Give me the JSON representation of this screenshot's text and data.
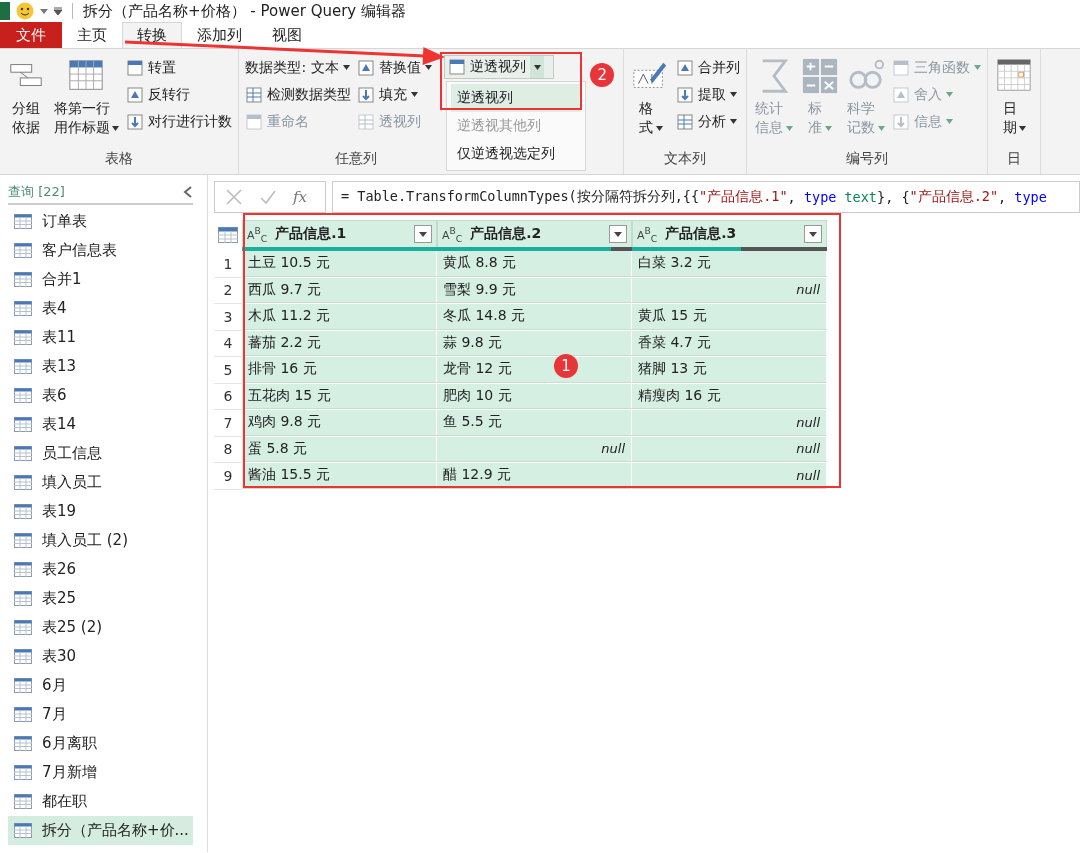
{
  "title_bar": {
    "title": "拆分（产品名称+价格） - Power Query 编辑器"
  },
  "tabs": [
    {
      "label": "文件",
      "kind": "file",
      "selected": false
    },
    {
      "label": "主页",
      "kind": "tab",
      "selected": false
    },
    {
      "label": "转换",
      "kind": "tab",
      "selected": true
    },
    {
      "label": "添加列",
      "kind": "tab",
      "selected": false
    },
    {
      "label": "视图",
      "kind": "tab",
      "selected": false
    }
  ],
  "ribbon": {
    "groups": [
      {
        "label": "表格",
        "columns": [
          {
            "kind": "large",
            "label": "分组依据",
            "dropdown": false,
            "disabled": false
          },
          {
            "kind": "large",
            "label": "将第一行用作标题",
            "dropdown": true,
            "disabled": false
          },
          {
            "kind": "stack",
            "items": [
              {
                "kind": "command",
                "label": "转置",
                "dropdown": false,
                "disabled": false
              },
              {
                "kind": "command",
                "label": "反转行",
                "dropdown": false,
                "disabled": false
              },
              {
                "kind": "command",
                "label": "对行进行计数",
                "dropdown": false,
                "disabled": false
              }
            ]
          }
        ]
      },
      {
        "label": "任意列",
        "columns": [
          {
            "kind": "stack",
            "items": [
              {
                "kind": "menu",
                "label": "数据类型: 文本",
                "dropdown": true,
                "disabled": false
              },
              {
                "kind": "command",
                "label": "检测数据类型",
                "dropdown": false,
                "disabled": false
              },
              {
                "kind": "command",
                "label": "重命名",
                "dropdown": false,
                "disabled": true
              }
            ]
          },
          {
            "kind": "stack",
            "items": [
              {
                "kind": "command",
                "label": "替换值",
                "dropdown": true,
                "disabled": false
              },
              {
                "kind": "command",
                "label": "填充",
                "dropdown": true,
                "disabled": false
              },
              {
                "kind": "command",
                "label": "透视列",
                "dropdown": false,
                "disabled": true
              }
            ]
          },
          {
            "kind": "split",
            "label": "逆透视列",
            "menu": [
              {
                "label": "逆透视列",
                "selected": true,
                "disabled": false
              },
              {
                "label": "逆透视其他列",
                "selected": false,
                "disabled": true
              },
              {
                "label": "仅逆透视选定列",
                "selected": false,
                "disabled": false
              }
            ]
          }
        ]
      },
      {
        "label": "文本列",
        "columns": [
          {
            "kind": "large",
            "label": "格式",
            "dropdown": true,
            "disabled": false
          },
          {
            "kind": "stack",
            "items": [
              {
                "kind": "command",
                "label": "合并列",
                "dropdown": false,
                "disabled": false
              },
              {
                "kind": "command",
                "label": "提取",
                "dropdown": true,
                "disabled": false
              },
              {
                "kind": "command",
                "label": "分析",
                "dropdown": true,
                "disabled": false
              }
            ]
          }
        ]
      },
      {
        "label": "编号列",
        "columns": [
          {
            "kind": "large",
            "label": "统计信息",
            "dropdown": true,
            "disabled": true
          },
          {
            "kind": "large",
            "label": "标准",
            "dropdown": true,
            "disabled": true
          },
          {
            "kind": "large",
            "label": "科学记数",
            "dropdown": true,
            "disabled": true
          },
          {
            "kind": "stack",
            "items": [
              {
                "kind": "command",
                "label": "三角函数",
                "dropdown": true,
                "disabled": true
              },
              {
                "kind": "command",
                "label": "舍入",
                "dropdown": true,
                "disabled": true
              },
              {
                "kind": "command",
                "label": "信息",
                "dropdown": true,
                "disabled": true
              }
            ]
          }
        ]
      },
      {
        "label": "日",
        "columns": [
          {
            "kind": "large",
            "label": "日期",
            "dropdown": true,
            "disabled": false
          }
        ]
      }
    ]
  },
  "sidebar": {
    "title": "查询 [22]",
    "items": [
      {
        "label": "订单表",
        "selected": false
      },
      {
        "label": "客户信息表",
        "selected": false
      },
      {
        "label": "合并1",
        "selected": false
      },
      {
        "label": "表4",
        "selected": false
      },
      {
        "label": "表11",
        "selected": false
      },
      {
        "label": "表13",
        "selected": false
      },
      {
        "label": "表6",
        "selected": false
      },
      {
        "label": "表14",
        "selected": false
      },
      {
        "label": "员工信息",
        "selected": false
      },
      {
        "label": "填入员工",
        "selected": false
      },
      {
        "label": "表19",
        "selected": false
      },
      {
        "label": "填入员工 (2)",
        "selected": false
      },
      {
        "label": "表26",
        "selected": false
      },
      {
        "label": "表25",
        "selected": false
      },
      {
        "label": "表25 (2)",
        "selected": false
      },
      {
        "label": "表30",
        "selected": false
      },
      {
        "label": "6月",
        "selected": false
      },
      {
        "label": "7月",
        "selected": false
      },
      {
        "label": "6月离职",
        "selected": false
      },
      {
        "label": "7月新增",
        "selected": false
      },
      {
        "label": "都在职",
        "selected": false
      },
      {
        "label": "拆分（产品名称+价...",
        "selected": true
      }
    ]
  },
  "formula_bar": {
    "fx": "fx",
    "tokens": [
      {
        "kind": "plain",
        "text": "= Table.TransformColumnTypes(按分隔符拆分列,{{"
      },
      {
        "kind": "string",
        "text": "\"产品信息.1\""
      },
      {
        "kind": "plain",
        "text": ", "
      },
      {
        "kind": "keyword",
        "text": "type"
      },
      {
        "kind": "type",
        "text": "text"
      },
      {
        "kind": "plain",
        "text": "}, {"
      },
      {
        "kind": "string",
        "text": "\"产品信息.2\""
      },
      {
        "kind": "plain",
        "text": ", "
      },
      {
        "kind": "keyword",
        "text": "type"
      }
    ]
  },
  "table": {
    "columns": [
      {
        "type": "A$^{B}$$_{C}$",
        "label": "产品信息.1",
        "selected": true,
        "level": 1
      },
      {
        "type": "A$^{B}$$_{C}$",
        "label": "产品信息.2",
        "selected": true,
        "level": 0.89
      },
      {
        "type": "A$^{B}$$_{C}$",
        "label": "产品信息.3",
        "selected": true,
        "level": 0.56
      }
    ],
    "rows": [
      {
        "number": "1",
        "cells": [
          {
            "kind": "value",
            "text": "土豆 10.5 元"
          },
          {
            "kind": "value",
            "text": "黄瓜 8.8 元"
          },
          {
            "kind": "value",
            "text": "白菜 3.2 元"
          }
        ]
      },
      {
        "number": "2",
        "cells": [
          {
            "kind": "value",
            "text": "西瓜 9.7 元"
          },
          {
            "kind": "value",
            "text": "雪梨 9.9 元"
          },
          {
            "kind": "null",
            "text": "null"
          }
        ]
      },
      {
        "number": "3",
        "cells": [
          {
            "kind": "value",
            "text": "木瓜 11.2 元"
          },
          {
            "kind": "value",
            "text": "冬瓜 14.8 元"
          },
          {
            "kind": "value",
            "text": "黄瓜 15 元"
          }
        ]
      },
      {
        "number": "4",
        "cells": [
          {
            "kind": "value",
            "text": "蕃茄 2.2 元"
          },
          {
            "kind": "value",
            "text": "蒜 9.8 元"
          },
          {
            "kind": "value",
            "text": "香菜 4.7 元"
          }
        ]
      },
      {
        "number": "5",
        "cells": [
          {
            "kind": "value",
            "text": "排骨 16 元"
          },
          {
            "kind": "value",
            "text": "龙骨 12 元"
          },
          {
            "kind": "value",
            "text": "猪脚 13 元"
          }
        ]
      },
      {
        "number": "6",
        "cells": [
          {
            "kind": "value",
            "text": "五花肉 15 元"
          },
          {
            "kind": "value",
            "text": "肥肉 10 元"
          },
          {
            "kind": "value",
            "text": "精瘦肉 16 元"
          }
        ]
      },
      {
        "number": "7",
        "cells": [
          {
            "kind": "value",
            "text": "鸡肉 9.8 元"
          },
          {
            "kind": "value",
            "text": "鱼 5.5 元"
          },
          {
            "kind": "null",
            "text": "null"
          }
        ]
      },
      {
        "number": "8",
        "cells": [
          {
            "kind": "value",
            "text": "蛋 5.8 元"
          },
          {
            "kind": "null",
            "text": "null"
          },
          {
            "kind": "null",
            "text": "null"
          }
        ]
      },
      {
        "number": "9",
        "cells": [
          {
            "kind": "value",
            "text": "酱油 15.5 元"
          },
          {
            "kind": "value",
            "text": "醋 12.9 元"
          },
          {
            "kind": "null",
            "text": "null"
          }
        ]
      }
    ]
  },
  "annotations": {
    "badges": [
      "1",
      "2"
    ]
  }
}
